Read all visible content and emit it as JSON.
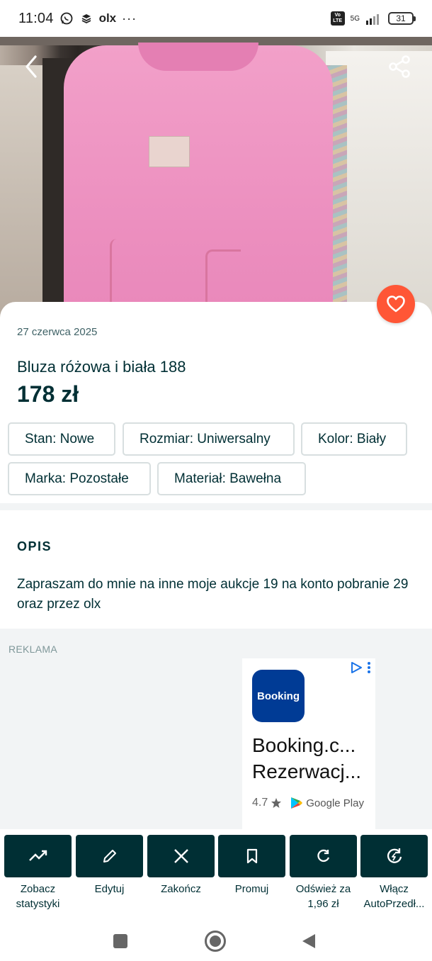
{
  "status_bar": {
    "time": "11:04",
    "left_icons": [
      "whatsapp-icon",
      "layers-icon",
      "olx-icon",
      "more-dots-icon"
    ],
    "olx_text": "olx",
    "dots": "···",
    "network": "5G",
    "volte": "Vo LTE",
    "battery": "31"
  },
  "hero": {
    "back_icon": "chevron-left-icon",
    "share_icon": "share-icon",
    "favorite_icon": "heart-icon"
  },
  "listing": {
    "date": "27 czerwca 2025",
    "title": "Bluza różowa i biała 188",
    "price": "178 zł",
    "params": [
      "Stan: Nowe",
      "Rozmiar: Uniwersalny",
      "Kolor: Biały",
      "Marka: Pozostałe",
      "Materiał: Bawełna"
    ]
  },
  "description": {
    "heading": "OPIS",
    "text": "Zapraszam do mnie na inne moje aukcje 19 na konto pobranie 29 oraz przez olx"
  },
  "ad": {
    "label": "REKLAMA",
    "app_icon_text": "Booking",
    "title_line1": "Booking.c...",
    "title_line2": "Rezerwacj...",
    "rating": "4.7",
    "store": "Google Play"
  },
  "actions": [
    {
      "label": "Zobacz statystyki",
      "icon": "trending-up-icon"
    },
    {
      "label": "Edytuj",
      "icon": "pencil-icon"
    },
    {
      "label": "Zakończ",
      "icon": "close-icon"
    },
    {
      "label": "Promuj",
      "icon": "bookmark-icon"
    },
    {
      "label": "Odśwież za 1,96 zł",
      "icon": "refresh-icon"
    },
    {
      "label": "Włącz AutoPrzedł...",
      "icon": "auto-refresh-icon"
    }
  ],
  "action_labels": {
    "a0_l1": "Zobacz",
    "a0_l2": "statystyki",
    "a1_l1": "Edytuj",
    "a2_l1": "Zakończ",
    "a3_l1": "Promuj",
    "a4_l1": "Odśwież za",
    "a4_l2": "1,96 zł",
    "a5_l1": "Włącz",
    "a5_l2": "AutoPrzedł..."
  },
  "colors": {
    "primary": "#002f34",
    "favorite": "#ff5636",
    "chip_border": "#d8dfe0",
    "ad_background": "#f2f4f5"
  }
}
